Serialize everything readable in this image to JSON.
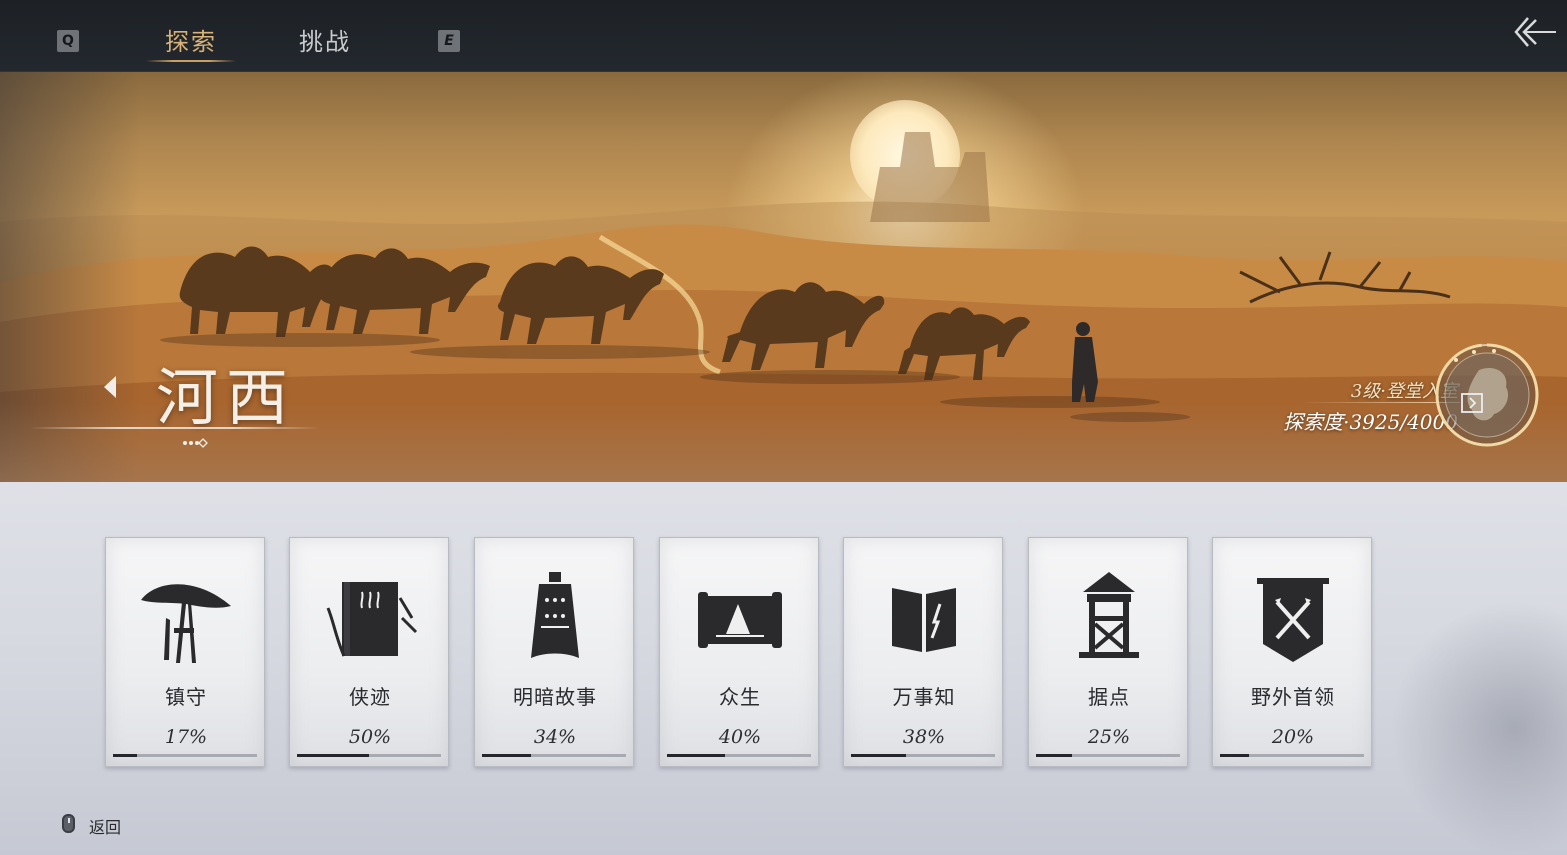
{
  "topbar": {
    "key_left": "Q",
    "key_right": "E",
    "tabs": [
      {
        "label": "探索",
        "active": true
      },
      {
        "label": "挑战",
        "active": false
      }
    ],
    "back_icon": "double-chevron-arrow-left-icon"
  },
  "region": {
    "name": "河西",
    "rank": "3级·登堂入室",
    "progress_text": "探索度·3925/4000",
    "progress_current": 3925,
    "progress_total": 4000
  },
  "categories": [
    {
      "label": "镇守",
      "percent_text": "17%",
      "percent": 17,
      "icon": "bamboo-hat-swords-icon"
    },
    {
      "label": "侠迹",
      "percent_text": "50%",
      "percent": 50,
      "icon": "book-bamboo-icon"
    },
    {
      "label": "明暗故事",
      "percent_text": "34%",
      "percent": 34,
      "icon": "bronze-bell-icon"
    },
    {
      "label": "众生",
      "percent_text": "40%",
      "percent": 40,
      "icon": "scroll-painting-icon"
    },
    {
      "label": "万事知",
      "percent_text": "38%",
      "percent": 38,
      "icon": "open-book-icon"
    },
    {
      "label": "据点",
      "percent_text": "25%",
      "percent": 25,
      "icon": "watchtower-icon"
    },
    {
      "label": "野外首领",
      "percent_text": "20%",
      "percent": 20,
      "icon": "crossed-swords-banner-icon"
    }
  ],
  "footer": {
    "return_label": "返回",
    "mouse_icon": "mouse-right-click-icon"
  },
  "colors": {
    "topbar_bg": "#1f2328",
    "tab_active": "#d8b278",
    "tab_inactive": "#c9cacb",
    "card_bg": "#efeff1",
    "icon_ink": "#2a2a2d"
  }
}
